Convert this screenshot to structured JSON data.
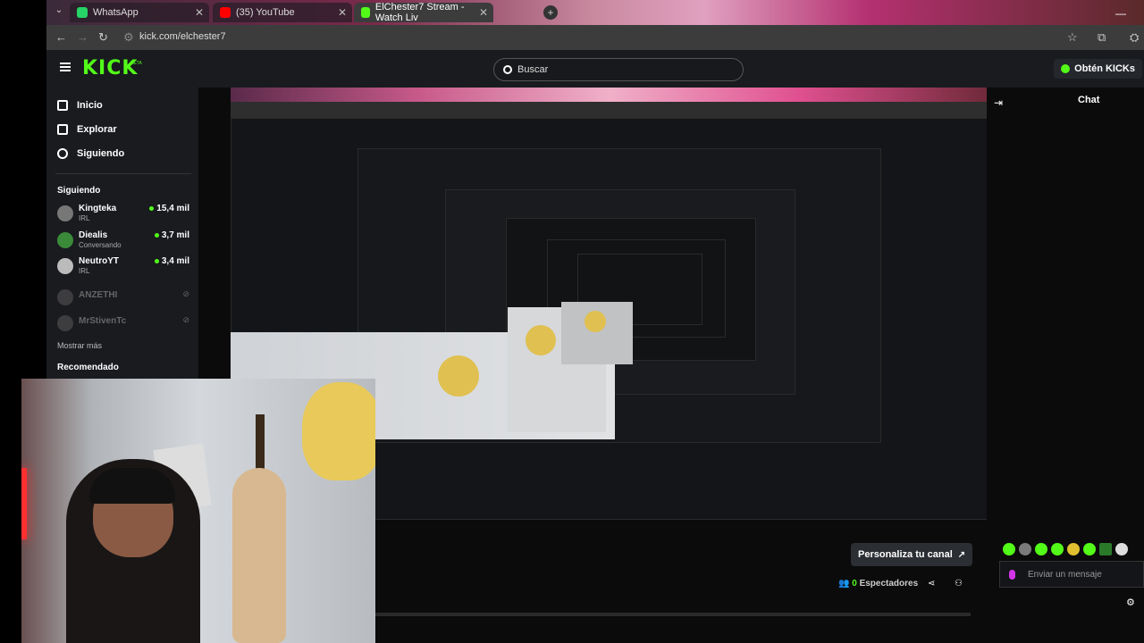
{
  "browser": {
    "tabs": [
      {
        "label": "WhatsApp",
        "color": "#25d366"
      },
      {
        "label": "(35) YouTube",
        "color": "#ff0000"
      },
      {
        "label": "ElChester7 Stream - Watch Liv",
        "color": "#53fc18"
      }
    ],
    "url": "kick.com/elchester7"
  },
  "header": {
    "logo": "KICK",
    "logo_badge": "BETA",
    "search_placeholder": "Buscar",
    "get_kicks": "Obtén KICKs"
  },
  "sidebar": {
    "nav": [
      {
        "label": "Inicio",
        "icon": "home-icon"
      },
      {
        "label": "Explorar",
        "icon": "browse-icon"
      },
      {
        "label": "Siguiendo",
        "icon": "heart-icon"
      }
    ],
    "following_title": "Siguiendo",
    "following": [
      {
        "name": "Kingteka",
        "category": "IRL",
        "viewers": "15,4 mil",
        "live": true
      },
      {
        "name": "Diealis",
        "category": "Conversando",
        "viewers": "3,7 mil",
        "live": true
      },
      {
        "name": "NeutroYT",
        "category": "IRL",
        "viewers": "3,4 mil",
        "live": true
      },
      {
        "name": "ANZETHI",
        "category": "",
        "viewers": "",
        "live": false
      },
      {
        "name": "MrStivenTc",
        "category": "",
        "viewers": "",
        "live": false
      }
    ],
    "show_more": "Mostrar más",
    "recommended_title": "Recomendado"
  },
  "main": {
    "customize_button": "Personaliza tu canal",
    "viewers_count": "0",
    "viewers_label": "Espectadores"
  },
  "chat": {
    "title": "Chat",
    "input_placeholder": "Enviar un mensaje"
  },
  "colors": {
    "kick_green": "#53fc18",
    "background": "#0b0b0c",
    "panel": "#191b1f"
  }
}
